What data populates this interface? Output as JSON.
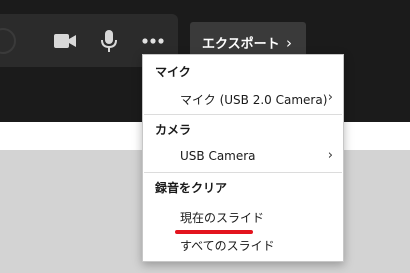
{
  "toolbar": {
    "export_label": "エクスポート",
    "icons": [
      "camera-icon",
      "microphone-icon",
      "more-options-icon",
      "chevron-right-icon"
    ]
  },
  "menu": {
    "mic_header": "マイク",
    "mic_item": "マイク (USB 2.0 Camera)",
    "camera_header": "カメラ",
    "camera_item": "USB Camera",
    "clear_header": "録音をクリア",
    "clear_current": "現在のスライド",
    "clear_all": "すべてのスライド"
  },
  "colors": {
    "toolbar_bg": "#1b1b1b",
    "button_bg": "#3a3a3a",
    "highlight_underline": "#e3141e"
  }
}
